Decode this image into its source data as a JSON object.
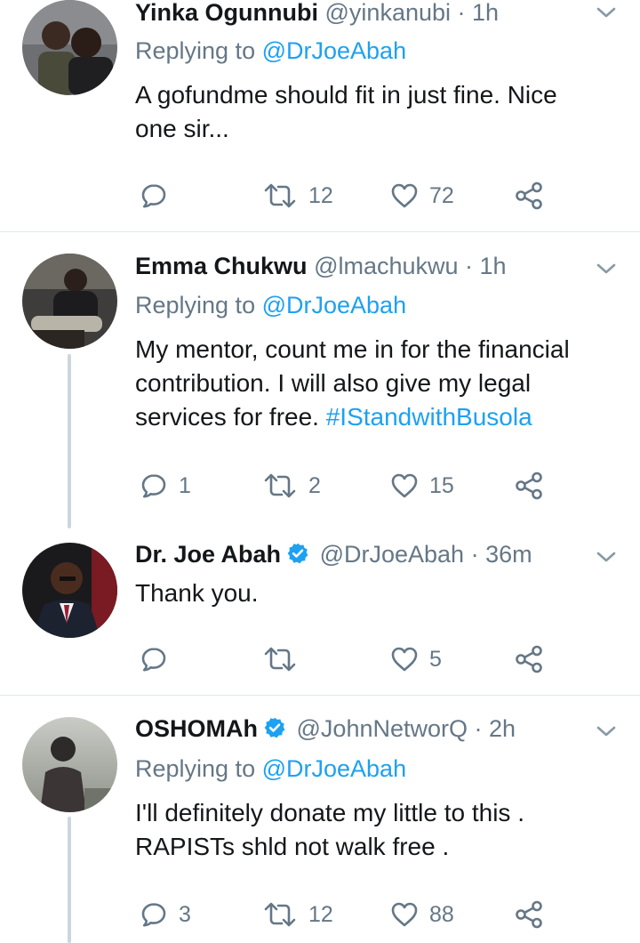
{
  "tweets": [
    {
      "name": "Yinka Ogunnubi",
      "handle": "@yinkanubi",
      "time": "· 1h",
      "replying_prefix": "Replying to ",
      "replying_to": "@DrJoeAbah",
      "text": "A gofundme should fit in just fine. Nice\none sir...",
      "hashtag": "",
      "reply_count": "",
      "retweet_count": "12",
      "like_count": "72"
    },
    {
      "name": "Emma Chukwu",
      "handle": "@lmachukwu",
      "time": "· 1h",
      "replying_prefix": "Replying to ",
      "replying_to": "@DrJoeAbah",
      "text": "My mentor, count me in for the financial\ncontribution. I will also give my legal\nservices for free. ",
      "hashtag": "#IStandwithBusola",
      "reply_count": "1",
      "retweet_count": "2",
      "like_count": "15"
    },
    {
      "name": "Dr. Joe Abah",
      "handle": "@DrJoeAbah",
      "time": "· 36m",
      "verified": true,
      "text": "Thank you.",
      "reply_count": "",
      "retweet_count": "",
      "like_count": "5"
    },
    {
      "name": "OSHOMAh",
      "handle": "@JohnNetworQ",
      "time": "· 2h",
      "verified": true,
      "replying_prefix": "Replying to ",
      "replying_to": "@DrJoeAbah",
      "text": "I'll definitely donate my little to this .\nRAPISTs shld not walk free .",
      "reply_count": "3",
      "retweet_count": "12",
      "like_count": "88"
    }
  ],
  "colors": {
    "text": "#14171a",
    "secondary": "#657786",
    "link": "#1da1f2",
    "divider": "#e1e8ed",
    "thread_line": "#ccd6dd",
    "verified": "#1da1f2"
  },
  "icons": [
    "reply-icon",
    "retweet-icon",
    "like-icon",
    "share-icon",
    "chevron-down-icon",
    "verified-badge-icon"
  ]
}
